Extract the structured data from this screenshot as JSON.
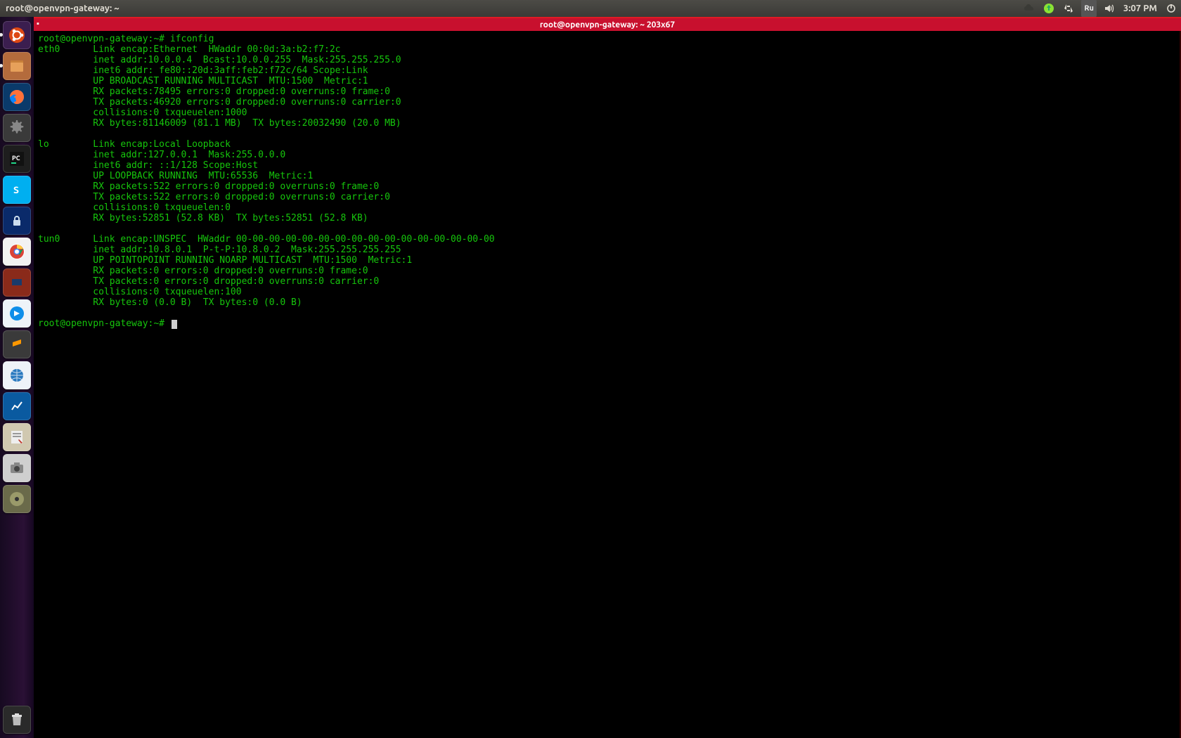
{
  "panel": {
    "app_title": "root@openvpn-gateway: ~",
    "lang_badge": "Ru",
    "time": "3:07 PM"
  },
  "launcher": {
    "items": [
      {
        "name": "dash",
        "bg": "#3b1e4f",
        "glyph": "ubuntu"
      },
      {
        "name": "files",
        "bg": "#b46b3c",
        "glyph": "files"
      },
      {
        "name": "firefox",
        "bg": "#0a3a6a",
        "glyph": "firefox"
      },
      {
        "name": "settings",
        "bg": "#3a3a3a",
        "glyph": "gear"
      },
      {
        "name": "pycharm",
        "bg": "#1e1e1e",
        "glyph": "pycharm"
      },
      {
        "name": "skype",
        "bg": "#00aff0",
        "glyph": "skype"
      },
      {
        "name": "keepass",
        "bg": "#0a2a6a",
        "glyph": "lock"
      },
      {
        "name": "chrome",
        "bg": "#f2f2f2",
        "glyph": "chrome"
      },
      {
        "name": "virtualbox",
        "bg": "#8a2a1a",
        "glyph": "vbox"
      },
      {
        "name": "teamviewer",
        "bg": "#eef3f8",
        "glyph": "tv"
      },
      {
        "name": "sublime",
        "bg": "#3a3a3a",
        "glyph": "sublime"
      },
      {
        "name": "remote",
        "bg": "#eef3f8",
        "glyph": "globe"
      },
      {
        "name": "monitor",
        "bg": "#0a5aa0",
        "glyph": "chart"
      },
      {
        "name": "gedit",
        "bg": "#d0c8b0",
        "glyph": "note"
      },
      {
        "name": "screenshot",
        "bg": "#cfcfcf",
        "glyph": "camera"
      },
      {
        "name": "disks",
        "bg": "#6a6a4a",
        "glyph": "disk"
      }
    ],
    "trash": {
      "name": "trash",
      "bg": "#2a2a2a",
      "glyph": "trash"
    }
  },
  "terminal": {
    "title": "root@openvpn-gateway: ~ 203x67",
    "prompt": "root@openvpn-gateway:~#",
    "command": "ifconfig",
    "prompt2": "root@openvpn-gateway:~#",
    "interfaces": [
      {
        "name": "eth0",
        "lines": [
          "Link encap:Ethernet  HWaddr 00:0d:3a:b2:f7:2c",
          "inet addr:10.0.0.4  Bcast:10.0.0.255  Mask:255.255.255.0",
          "inet6 addr: fe80::20d:3aff:feb2:f72c/64 Scope:Link",
          "UP BROADCAST RUNNING MULTICAST  MTU:1500  Metric:1",
          "RX packets:78495 errors:0 dropped:0 overruns:0 frame:0",
          "TX packets:46920 errors:0 dropped:0 overruns:0 carrier:0",
          "collisions:0 txqueuelen:1000",
          "RX bytes:81146009 (81.1 MB)  TX bytes:20032490 (20.0 MB)"
        ]
      },
      {
        "name": "lo",
        "lines": [
          "Link encap:Local Loopback",
          "inet addr:127.0.0.1  Mask:255.0.0.0",
          "inet6 addr: ::1/128 Scope:Host",
          "UP LOOPBACK RUNNING  MTU:65536  Metric:1",
          "RX packets:522 errors:0 dropped:0 overruns:0 frame:0",
          "TX packets:522 errors:0 dropped:0 overruns:0 carrier:0",
          "collisions:0 txqueuelen:0",
          "RX bytes:52851 (52.8 KB)  TX bytes:52851 (52.8 KB)"
        ]
      },
      {
        "name": "tun0",
        "lines": [
          "Link encap:UNSPEC  HWaddr 00-00-00-00-00-00-00-00-00-00-00-00-00-00-00-00",
          "inet addr:10.8.0.1  P-t-P:10.8.0.2  Mask:255.255.255.255",
          "UP POINTOPOINT RUNNING NOARP MULTICAST  MTU:1500  Metric:1",
          "RX packets:0 errors:0 dropped:0 overruns:0 frame:0",
          "TX packets:0 errors:0 dropped:0 overruns:0 carrier:0",
          "collisions:0 txqueuelen:100",
          "RX bytes:0 (0.0 B)  TX bytes:0 (0.0 B)"
        ]
      }
    ]
  }
}
